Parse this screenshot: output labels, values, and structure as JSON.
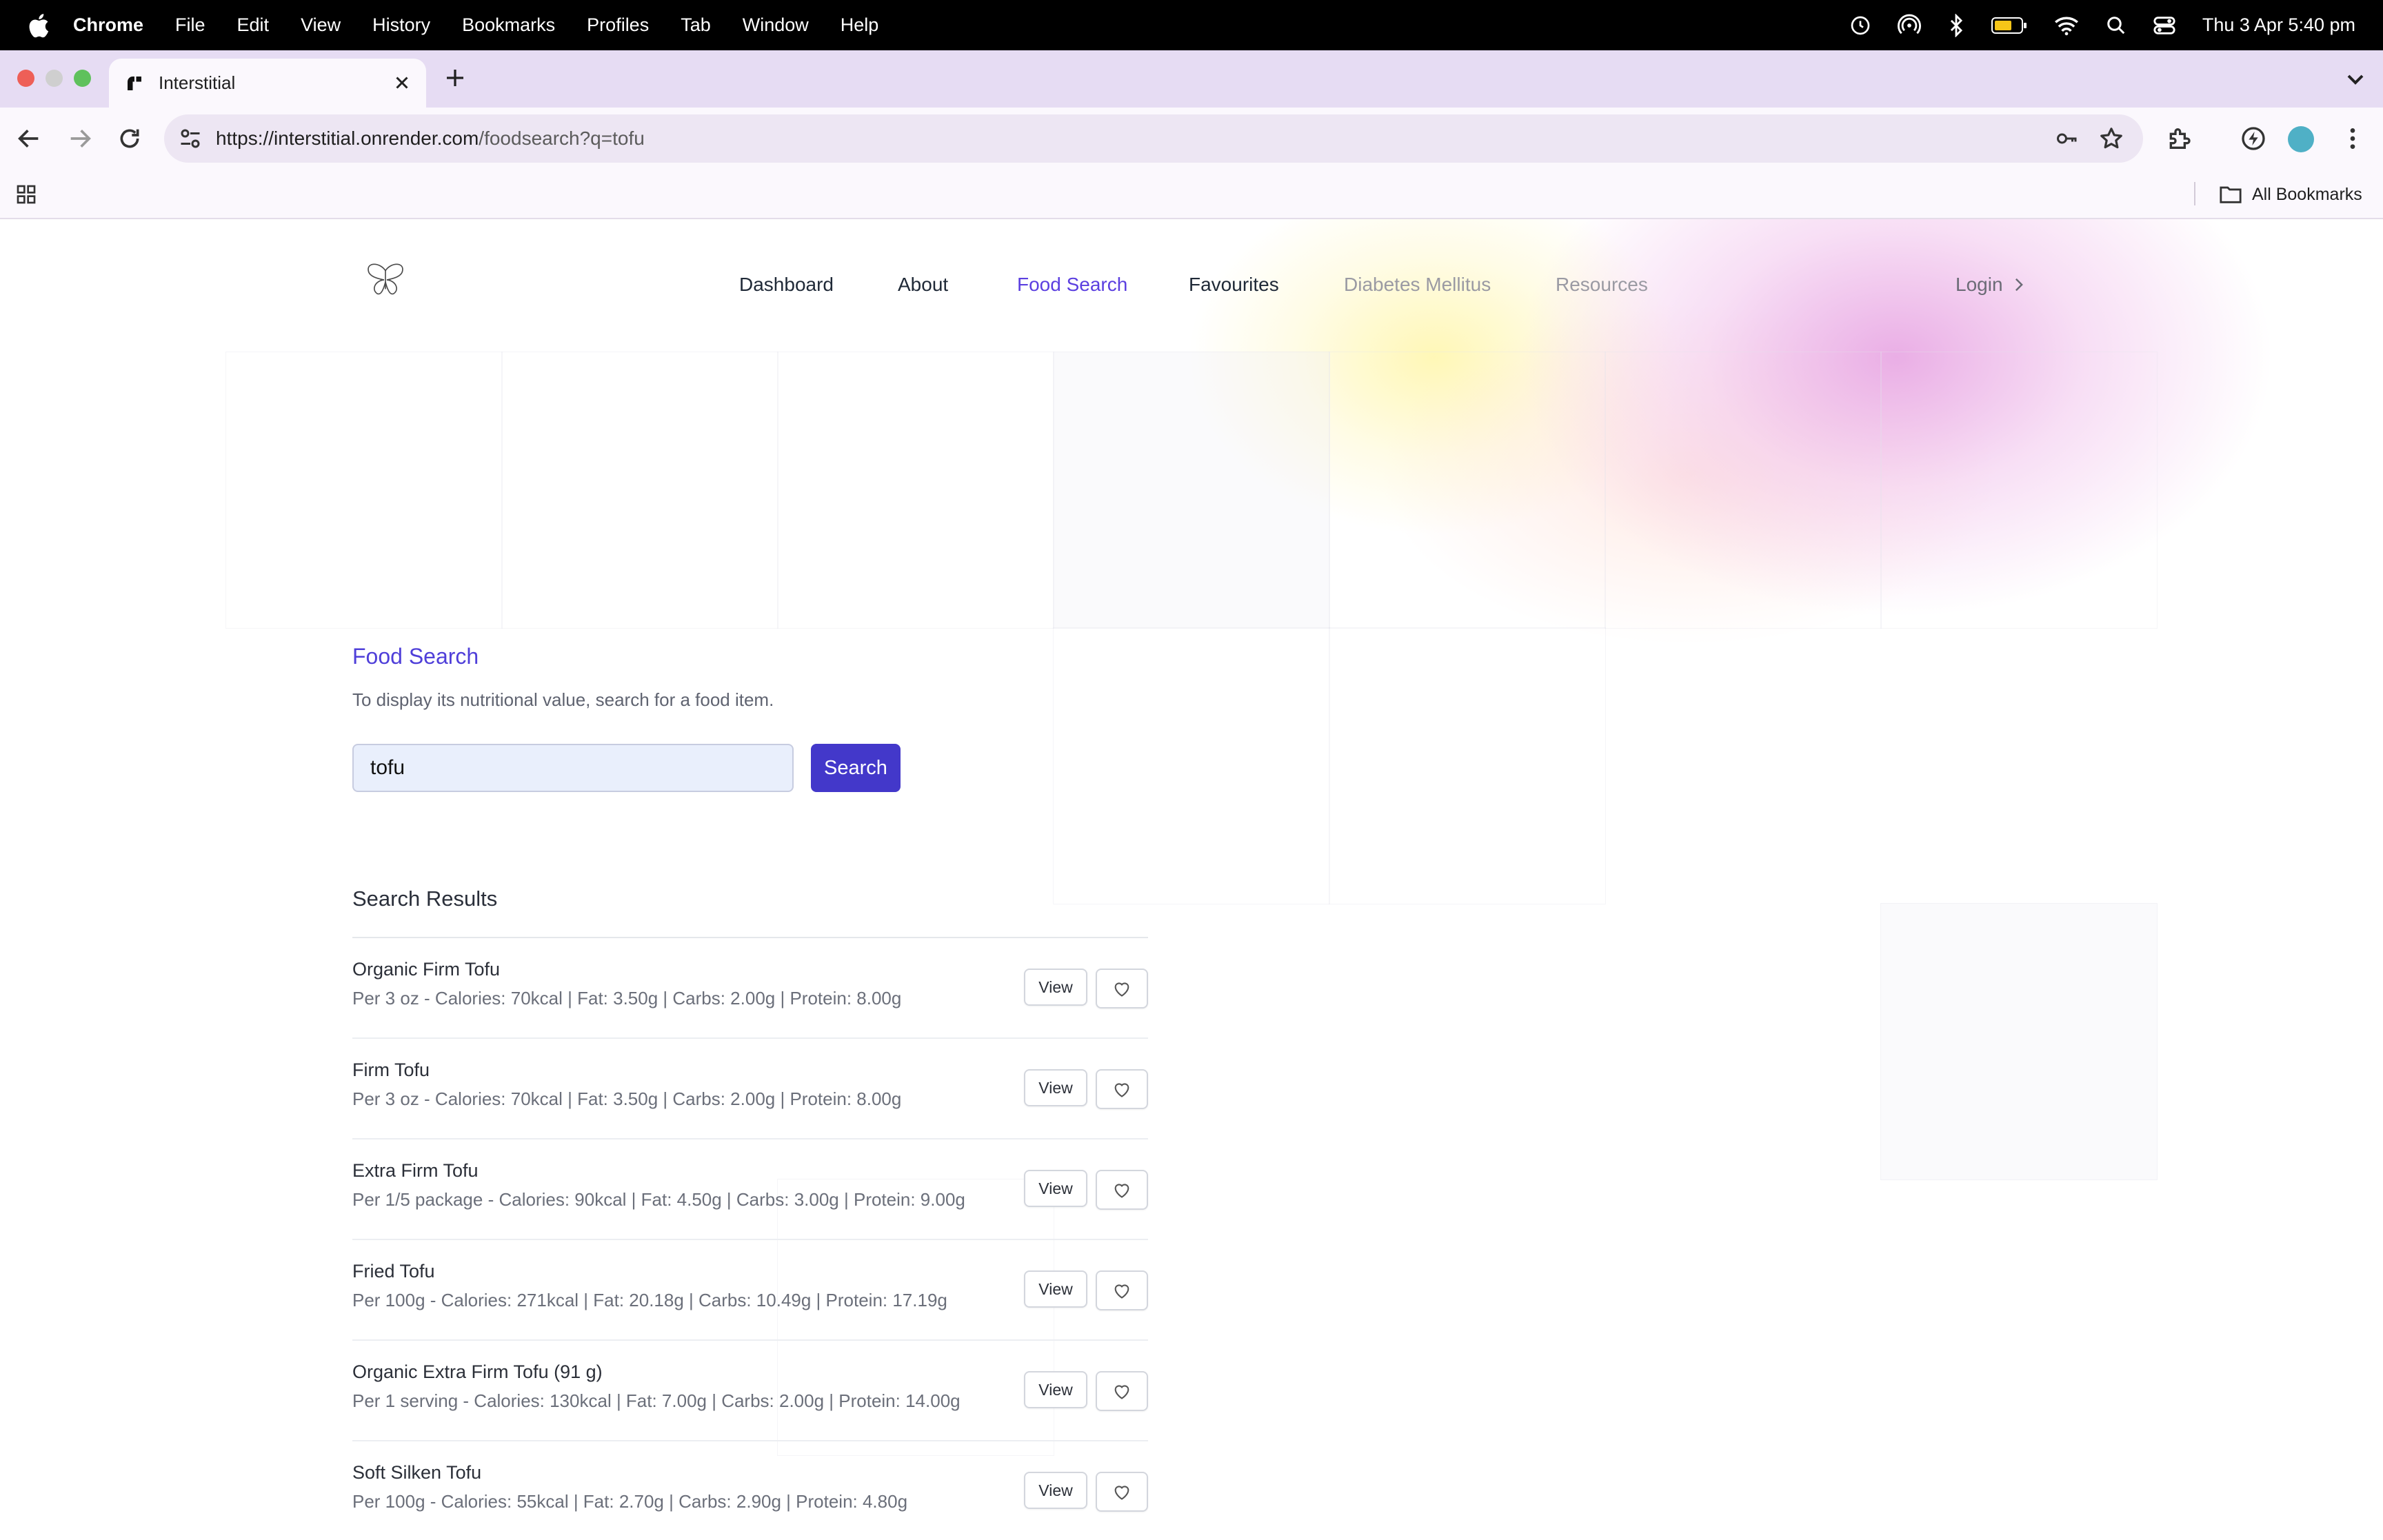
{
  "menubar": {
    "app_name": "Chrome",
    "items": [
      "File",
      "Edit",
      "View",
      "History",
      "Bookmarks",
      "Profiles",
      "Tab",
      "Window",
      "Help"
    ],
    "clock": "Thu 3 Apr  5:40 pm"
  },
  "browser": {
    "tab_title": "Interstitial",
    "url_host": "https://interstitial.onrender.com",
    "url_path": "/foodsearch?q=tofu",
    "bookmarks_label": "All Bookmarks"
  },
  "nav": {
    "links": [
      {
        "label": "Dashboard",
        "state": "normal"
      },
      {
        "label": "About",
        "state": "normal"
      },
      {
        "label": "Food Search",
        "state": "active"
      },
      {
        "label": "Favourites",
        "state": "normal"
      },
      {
        "label": "Diabetes Mellitus",
        "state": "muted"
      },
      {
        "label": "Resources",
        "state": "muted"
      }
    ],
    "login": "Login"
  },
  "search": {
    "heading": "Food Search",
    "subtitle": "To display its nutritional value, search for a food item.",
    "query": "tofu",
    "button": "Search"
  },
  "results": {
    "title": "Search Results",
    "view_label": "View",
    "items": [
      {
        "name": "Organic Firm Tofu",
        "detail": "Per 3 oz - Calories: 70kcal | Fat: 3.50g | Carbs: 2.00g | Protein: 8.00g"
      },
      {
        "name": "Firm Tofu",
        "detail": "Per 3 oz - Calories: 70kcal | Fat: 3.50g | Carbs: 2.00g | Protein: 8.00g"
      },
      {
        "name": "Extra Firm Tofu",
        "detail": "Per 1/5 package - Calories: 90kcal | Fat: 4.50g | Carbs: 3.00g | Protein: 9.00g"
      },
      {
        "name": "Fried Tofu",
        "detail": "Per 100g - Calories: 271kcal | Fat: 20.18g | Carbs: 10.49g | Protein: 17.19g"
      },
      {
        "name": "Organic Extra Firm Tofu (91 g)",
        "detail": "Per 1 serving - Calories: 130kcal | Fat: 7.00g | Carbs: 2.00g | Protein: 14.00g"
      },
      {
        "name": "Soft Silken Tofu",
        "detail": "Per 100g - Calories: 55kcal | Fat: 2.70g | Carbs: 2.90g | Protein: 4.80g"
      }
    ]
  },
  "colors": {
    "accent": "#4338ca",
    "active_link": "#5b3fe0",
    "tabstrip": "#e6dcf3"
  }
}
